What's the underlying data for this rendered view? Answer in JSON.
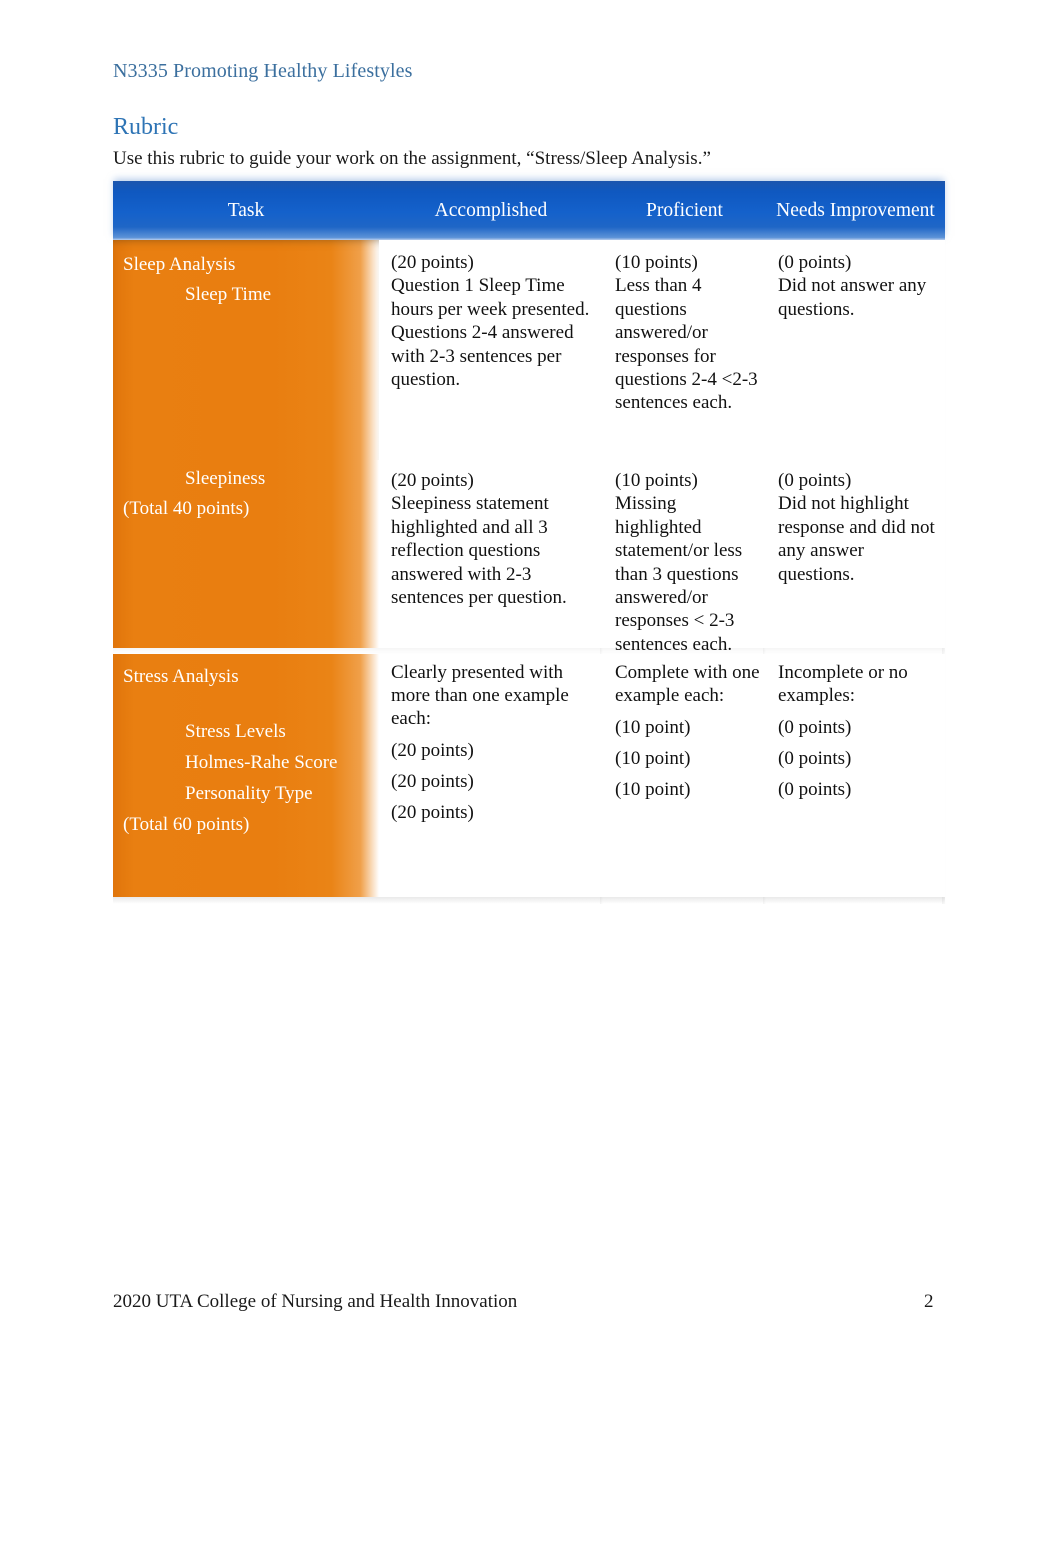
{
  "document": {
    "running_header": "N3335 Promoting Healthy Lifestyles",
    "heading": "Rubric",
    "intro": "Use this rubric to guide your work on the assignment, “Stress/Sleep Analysis.”",
    "footer_text": "2020 UTA College of Nursing and Health Innovation",
    "page_number": "2"
  },
  "colors": {
    "header_blue": "#2e74b5",
    "running_header_blue": "#3b6f9e",
    "table_header_blue": "#1461cb",
    "task_column_orange": "#e97f11",
    "body_text": "#111111"
  },
  "table": {
    "columns": [
      "Task",
      "Accomplished",
      "Proficient",
      "Needs Improvement"
    ],
    "rows": [
      {
        "task": {
          "title": "Sleep Analysis",
          "sub_items": [
            "Sleep Time"
          ],
          "total": ""
        },
        "accomplished": {
          "points": "(20 points)",
          "text": "Question 1 Sleep Time hours per week presented. Questions 2-4 answered with 2-3 sentences per question."
        },
        "proficient": {
          "points": "(10 points)",
          "text": "Less than 4 questions answered/or responses for questions 2-4 <2-3 sentences each."
        },
        "needs_improvement": {
          "points": "(0 points)",
          "text": "Did not answer any questions."
        }
      },
      {
        "task": {
          "title": "",
          "sub_items": [
            "Sleepiness"
          ],
          "total": "(Total 40 points)"
        },
        "accomplished": {
          "points": "(20 points)",
          "text": "Sleepiness statement highlighted and all 3 reflection questions answered with 2-3 sentences per question."
        },
        "proficient": {
          "points": "(10 points)",
          "text": "Missing highlighted statement/or less than 3 questions answered/or responses < 2-3 sentences each."
        },
        "needs_improvement": {
          "points": "(0 points)",
          "text": "Did not highlight response and did not any answer questions."
        }
      },
      {
        "task": {
          "title": "Stress Analysis",
          "sub_items": [
            "Stress Levels",
            "Holmes-Rahe Score",
            "Personality Type"
          ],
          "total": "(Total 60 points)"
        },
        "accomplished": {
          "heading": "Clearly presented with more than one example each:",
          "points_list": [
            "(20 points)",
            "(20 points)",
            "(20 points)"
          ]
        },
        "proficient": {
          "heading": "Complete with one example each:",
          "points_list": [
            "(10 point)",
            "(10 point)",
            "(10 point)"
          ]
        },
        "needs_improvement": {
          "heading": "Incomplete or no examples:",
          "points_list": [
            "(0 points)",
            "(0 points)",
            "(0 points)"
          ]
        }
      }
    ]
  }
}
